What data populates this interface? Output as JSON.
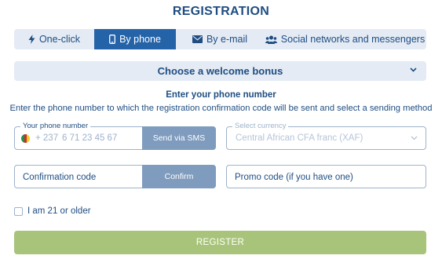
{
  "title": "REGISTRATION",
  "tabs": [
    {
      "label": "One-click",
      "icon": "lightning-icon"
    },
    {
      "label": "By phone",
      "icon": "phone-icon"
    },
    {
      "label": "By e-mail",
      "icon": "envelope-icon"
    },
    {
      "label": "Social networks and messengers",
      "icon": "users-icon"
    }
  ],
  "active_tab": "By phone",
  "bonus": {
    "label": "Choose a welcome bonus"
  },
  "heading": "Enter your phone number",
  "subheading": "Enter the phone number to which the registration confirmation code will be sent and select a sending method",
  "phone": {
    "legend": "Your phone number",
    "country_code": "+ 237",
    "placeholder": "6 71 23 45 67",
    "value": "",
    "send_button": "Send via SMS"
  },
  "currency": {
    "legend": "Select currency",
    "value": "Central African CFA franc (XAF)"
  },
  "confirmation": {
    "placeholder": "Confirmation code",
    "button": "Confirm"
  },
  "promo": {
    "placeholder": "Promo code (if you have one)"
  },
  "age_checkbox": {
    "label": "I am 21 or older",
    "checked": false
  },
  "register_button": "REGISTER",
  "colors": {
    "primary": "#1f4d82",
    "active_tab": "#2563a8",
    "tab_bg": "#e4ebf4",
    "grey_button": "#7f9bbd",
    "register": "#a8c47a",
    "border": "#9db3cc"
  }
}
